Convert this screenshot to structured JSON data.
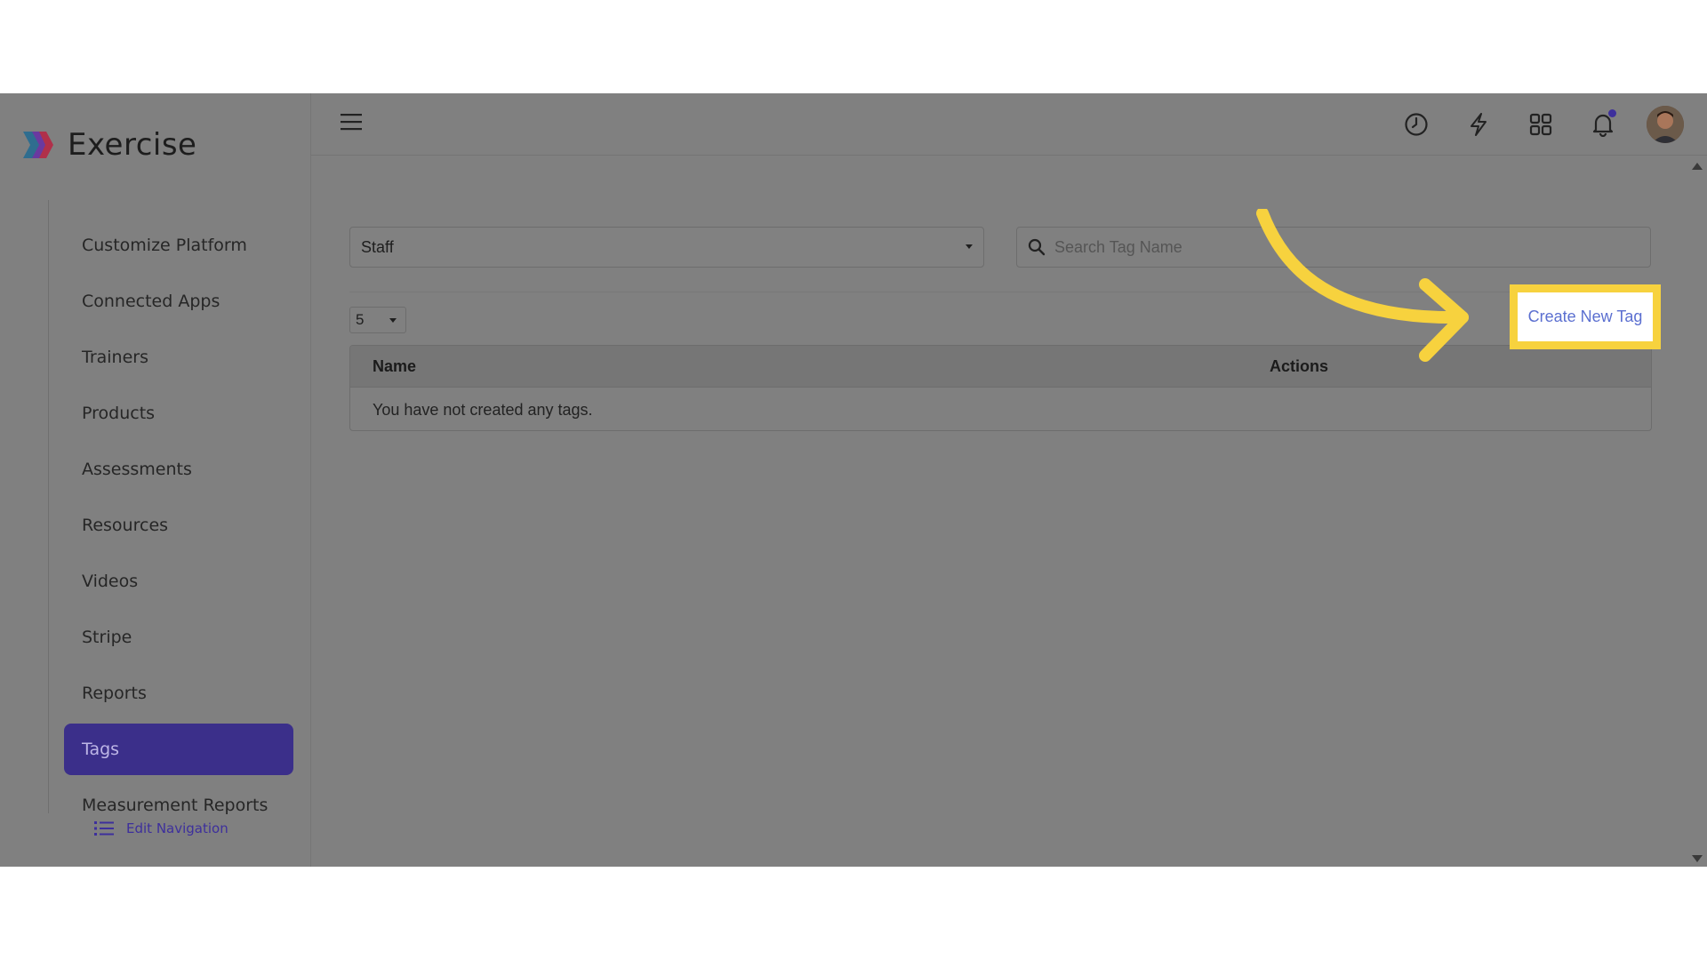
{
  "brand": {
    "name": "Exercise",
    "logo_icon": "exercise-logo-icon"
  },
  "sidebar": {
    "items": [
      {
        "label": "Customize Platform",
        "active": false
      },
      {
        "label": "Connected Apps",
        "active": false
      },
      {
        "label": "Trainers",
        "active": false
      },
      {
        "label": "Products",
        "active": false
      },
      {
        "label": "Assessments",
        "active": false
      },
      {
        "label": "Resources",
        "active": false
      },
      {
        "label": "Videos",
        "active": false
      },
      {
        "label": "Stripe",
        "active": false
      },
      {
        "label": "Reports",
        "active": false
      },
      {
        "label": "Tags",
        "active": true
      },
      {
        "label": "Measurement Reports",
        "active": false
      }
    ],
    "edit_navigation_label": "Edit Navigation"
  },
  "topbar": {
    "icons": [
      "menu-icon",
      "history-icon",
      "lightning-icon",
      "apps-grid-icon",
      "notification-bell-icon",
      "user-avatar"
    ]
  },
  "filters": {
    "staff_select_value": "Staff",
    "search_placeholder": "Search Tag Name",
    "page_size_value": "5"
  },
  "actions": {
    "create_label": "Create New Tag"
  },
  "table": {
    "columns": [
      "Name",
      "Actions"
    ],
    "empty_message": "You have not created any tags."
  },
  "colors": {
    "accent": "#3b2f8a",
    "highlight": "#f7d23e",
    "link": "#5b6fd0"
  }
}
